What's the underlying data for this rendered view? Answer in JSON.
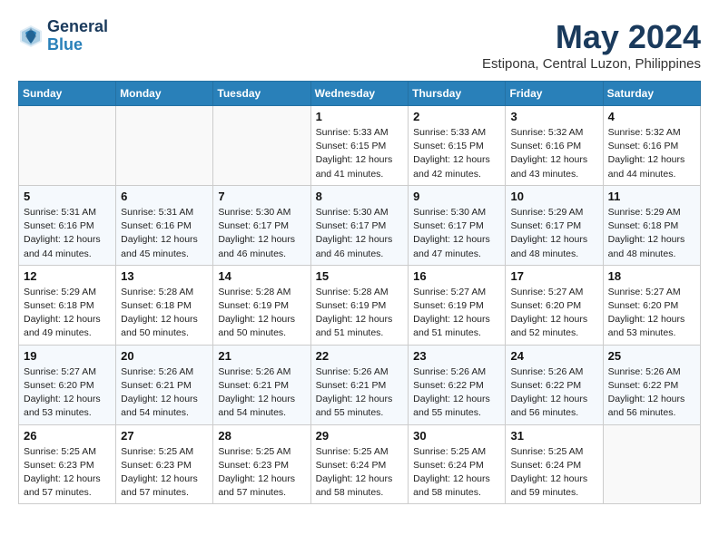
{
  "header": {
    "logo_line1": "General",
    "logo_line2": "Blue",
    "month_year": "May 2024",
    "location": "Estipona, Central Luzon, Philippines"
  },
  "days_of_week": [
    "Sunday",
    "Monday",
    "Tuesday",
    "Wednesday",
    "Thursday",
    "Friday",
    "Saturday"
  ],
  "weeks": [
    [
      {
        "day": "",
        "info": ""
      },
      {
        "day": "",
        "info": ""
      },
      {
        "day": "",
        "info": ""
      },
      {
        "day": "1",
        "info": "Sunrise: 5:33 AM\nSunset: 6:15 PM\nDaylight: 12 hours\nand 41 minutes."
      },
      {
        "day": "2",
        "info": "Sunrise: 5:33 AM\nSunset: 6:15 PM\nDaylight: 12 hours\nand 42 minutes."
      },
      {
        "day": "3",
        "info": "Sunrise: 5:32 AM\nSunset: 6:16 PM\nDaylight: 12 hours\nand 43 minutes."
      },
      {
        "day": "4",
        "info": "Sunrise: 5:32 AM\nSunset: 6:16 PM\nDaylight: 12 hours\nand 44 minutes."
      }
    ],
    [
      {
        "day": "5",
        "info": "Sunrise: 5:31 AM\nSunset: 6:16 PM\nDaylight: 12 hours\nand 44 minutes."
      },
      {
        "day": "6",
        "info": "Sunrise: 5:31 AM\nSunset: 6:16 PM\nDaylight: 12 hours\nand 45 minutes."
      },
      {
        "day": "7",
        "info": "Sunrise: 5:30 AM\nSunset: 6:17 PM\nDaylight: 12 hours\nand 46 minutes."
      },
      {
        "day": "8",
        "info": "Sunrise: 5:30 AM\nSunset: 6:17 PM\nDaylight: 12 hours\nand 46 minutes."
      },
      {
        "day": "9",
        "info": "Sunrise: 5:30 AM\nSunset: 6:17 PM\nDaylight: 12 hours\nand 47 minutes."
      },
      {
        "day": "10",
        "info": "Sunrise: 5:29 AM\nSunset: 6:17 PM\nDaylight: 12 hours\nand 48 minutes."
      },
      {
        "day": "11",
        "info": "Sunrise: 5:29 AM\nSunset: 6:18 PM\nDaylight: 12 hours\nand 48 minutes."
      }
    ],
    [
      {
        "day": "12",
        "info": "Sunrise: 5:29 AM\nSunset: 6:18 PM\nDaylight: 12 hours\nand 49 minutes."
      },
      {
        "day": "13",
        "info": "Sunrise: 5:28 AM\nSunset: 6:18 PM\nDaylight: 12 hours\nand 50 minutes."
      },
      {
        "day": "14",
        "info": "Sunrise: 5:28 AM\nSunset: 6:19 PM\nDaylight: 12 hours\nand 50 minutes."
      },
      {
        "day": "15",
        "info": "Sunrise: 5:28 AM\nSunset: 6:19 PM\nDaylight: 12 hours\nand 51 minutes."
      },
      {
        "day": "16",
        "info": "Sunrise: 5:27 AM\nSunset: 6:19 PM\nDaylight: 12 hours\nand 51 minutes."
      },
      {
        "day": "17",
        "info": "Sunrise: 5:27 AM\nSunset: 6:20 PM\nDaylight: 12 hours\nand 52 minutes."
      },
      {
        "day": "18",
        "info": "Sunrise: 5:27 AM\nSunset: 6:20 PM\nDaylight: 12 hours\nand 53 minutes."
      }
    ],
    [
      {
        "day": "19",
        "info": "Sunrise: 5:27 AM\nSunset: 6:20 PM\nDaylight: 12 hours\nand 53 minutes."
      },
      {
        "day": "20",
        "info": "Sunrise: 5:26 AM\nSunset: 6:21 PM\nDaylight: 12 hours\nand 54 minutes."
      },
      {
        "day": "21",
        "info": "Sunrise: 5:26 AM\nSunset: 6:21 PM\nDaylight: 12 hours\nand 54 minutes."
      },
      {
        "day": "22",
        "info": "Sunrise: 5:26 AM\nSunset: 6:21 PM\nDaylight: 12 hours\nand 55 minutes."
      },
      {
        "day": "23",
        "info": "Sunrise: 5:26 AM\nSunset: 6:22 PM\nDaylight: 12 hours\nand 55 minutes."
      },
      {
        "day": "24",
        "info": "Sunrise: 5:26 AM\nSunset: 6:22 PM\nDaylight: 12 hours\nand 56 minutes."
      },
      {
        "day": "25",
        "info": "Sunrise: 5:26 AM\nSunset: 6:22 PM\nDaylight: 12 hours\nand 56 minutes."
      }
    ],
    [
      {
        "day": "26",
        "info": "Sunrise: 5:25 AM\nSunset: 6:23 PM\nDaylight: 12 hours\nand 57 minutes."
      },
      {
        "day": "27",
        "info": "Sunrise: 5:25 AM\nSunset: 6:23 PM\nDaylight: 12 hours\nand 57 minutes."
      },
      {
        "day": "28",
        "info": "Sunrise: 5:25 AM\nSunset: 6:23 PM\nDaylight: 12 hours\nand 57 minutes."
      },
      {
        "day": "29",
        "info": "Sunrise: 5:25 AM\nSunset: 6:24 PM\nDaylight: 12 hours\nand 58 minutes."
      },
      {
        "day": "30",
        "info": "Sunrise: 5:25 AM\nSunset: 6:24 PM\nDaylight: 12 hours\nand 58 minutes."
      },
      {
        "day": "31",
        "info": "Sunrise: 5:25 AM\nSunset: 6:24 PM\nDaylight: 12 hours\nand 59 minutes."
      },
      {
        "day": "",
        "info": ""
      }
    ]
  ]
}
